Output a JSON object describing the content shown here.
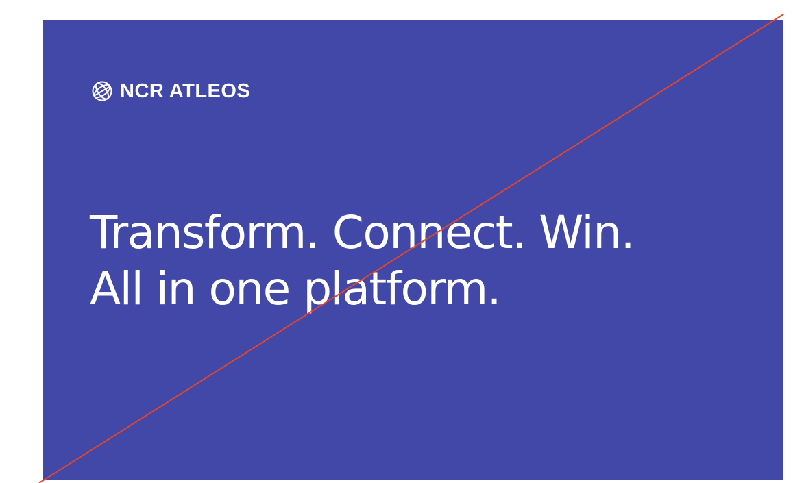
{
  "banner": {
    "background_color": "#4248a8",
    "logo": {
      "icon": "globe-icon",
      "text": "NCR ATLEOS"
    },
    "headline": {
      "line1": "Transform. Connect. Win.",
      "line2": "All in one platform."
    }
  },
  "overlay": {
    "strike_color": "#e2452b"
  }
}
